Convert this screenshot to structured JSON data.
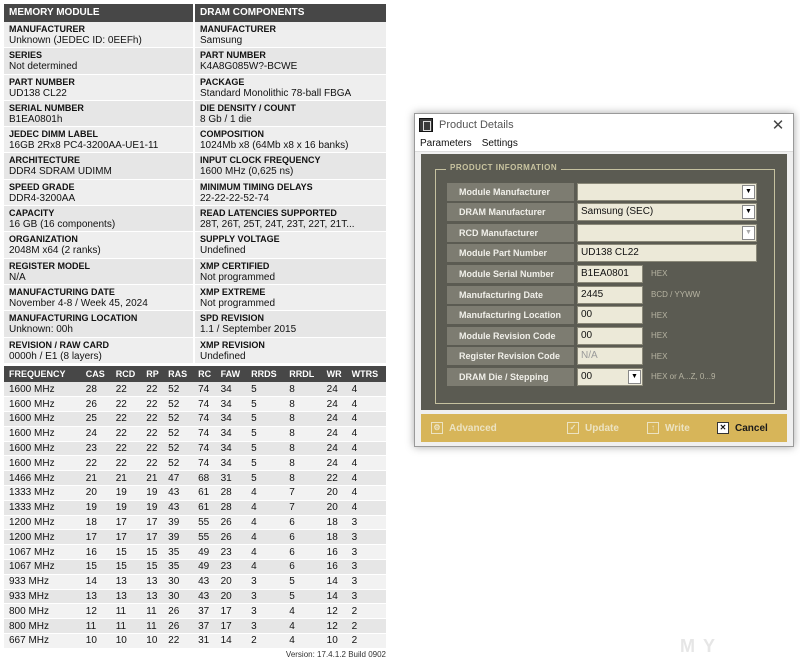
{
  "left_panel": {
    "headers": {
      "module": "MEMORY MODULE",
      "dram": "DRAM COMPONENTS"
    },
    "rows": [
      {
        "l_label": "MANUFACTURER",
        "l_value": "Unknown (JEDEC ID: 0EEFh)",
        "r_label": "MANUFACTURER",
        "r_value": "Samsung"
      },
      {
        "l_label": "SERIES",
        "l_value": "Not determined",
        "r_label": "PART NUMBER",
        "r_value": "K4A8G085W?-BCWE"
      },
      {
        "l_label": "PART NUMBER",
        "l_value": "UD138 CL22",
        "r_label": "PACKAGE",
        "r_value": "Standard Monolithic 78-ball FBGA"
      },
      {
        "l_label": "SERIAL NUMBER",
        "l_value": "B1EA0801h",
        "r_label": "DIE DENSITY / COUNT",
        "r_value": "8 Gb / 1 die"
      },
      {
        "l_label": "JEDEC DIMM LABEL",
        "l_value": "16GB 2Rx8 PC4-3200AA-UE1-11",
        "r_label": "COMPOSITION",
        "r_value": "1024Mb x8 (64Mb x8 x 16 banks)"
      },
      {
        "l_label": "ARCHITECTURE",
        "l_value": "DDR4 SDRAM UDIMM",
        "r_label": "INPUT CLOCK FREQUENCY",
        "r_value": "1600 MHz (0,625 ns)"
      },
      {
        "l_label": "SPEED GRADE",
        "l_value": "DDR4-3200AA",
        "r_label": "MINIMUM TIMING DELAYS",
        "r_value": "22-22-22-52-74"
      },
      {
        "l_label": "CAPACITY",
        "l_value": "16 GB (16 components)",
        "r_label": "READ LATENCIES SUPPORTED",
        "r_value": "28T, 26T, 25T, 24T, 23T, 22T, 21T..."
      },
      {
        "l_label": "ORGANIZATION",
        "l_value": "2048M x64 (2 ranks)",
        "r_label": "SUPPLY VOLTAGE",
        "r_value": "Undefined"
      },
      {
        "l_label": "REGISTER MODEL",
        "l_value": "N/A",
        "r_label": "XMP CERTIFIED",
        "r_value": "Not programmed"
      },
      {
        "l_label": "MANUFACTURING DATE",
        "l_value": "November 4-8 / Week 45, 2024",
        "r_label": "XMP EXTREME",
        "r_value": "Not programmed"
      },
      {
        "l_label": "MANUFACTURING LOCATION",
        "l_value": "Unknown: 00h",
        "r_label": "SPD REVISION",
        "r_value": "1.1 / September 2015"
      },
      {
        "l_label": "REVISION / RAW CARD",
        "l_value": "0000h / E1 (8 layers)",
        "r_label": "XMP REVISION",
        "r_value": "Undefined"
      }
    ],
    "timings": {
      "columns": [
        "FREQUENCY",
        "CAS",
        "RCD",
        "RP",
        "RAS",
        "RC",
        "FAW",
        "RRDS",
        "RRDL",
        "WR",
        "WTRS"
      ],
      "rows": [
        [
          "1600 MHz",
          "28",
          "22",
          "22",
          "52",
          "74",
          "34",
          "5",
          "8",
          "24",
          "4"
        ],
        [
          "1600 MHz",
          "26",
          "22",
          "22",
          "52",
          "74",
          "34",
          "5",
          "8",
          "24",
          "4"
        ],
        [
          "1600 MHz",
          "25",
          "22",
          "22",
          "52",
          "74",
          "34",
          "5",
          "8",
          "24",
          "4"
        ],
        [
          "1600 MHz",
          "24",
          "22",
          "22",
          "52",
          "74",
          "34",
          "5",
          "8",
          "24",
          "4"
        ],
        [
          "1600 MHz",
          "23",
          "22",
          "22",
          "52",
          "74",
          "34",
          "5",
          "8",
          "24",
          "4"
        ],
        [
          "1600 MHz",
          "22",
          "22",
          "22",
          "52",
          "74",
          "34",
          "5",
          "8",
          "24",
          "4"
        ],
        [
          "1466 MHz",
          "21",
          "21",
          "21",
          "47",
          "68",
          "31",
          "5",
          "8",
          "22",
          "4"
        ],
        [
          "1333 MHz",
          "20",
          "19",
          "19",
          "43",
          "61",
          "28",
          "4",
          "7",
          "20",
          "4"
        ],
        [
          "1333 MHz",
          "19",
          "19",
          "19",
          "43",
          "61",
          "28",
          "4",
          "7",
          "20",
          "4"
        ],
        [
          "1200 MHz",
          "18",
          "17",
          "17",
          "39",
          "55",
          "26",
          "4",
          "6",
          "18",
          "3"
        ],
        [
          "1200 MHz",
          "17",
          "17",
          "17",
          "39",
          "55",
          "26",
          "4",
          "6",
          "18",
          "3"
        ],
        [
          "1067 MHz",
          "16",
          "15",
          "15",
          "35",
          "49",
          "23",
          "4",
          "6",
          "16",
          "3"
        ],
        [
          "1067 MHz",
          "15",
          "15",
          "15",
          "35",
          "49",
          "23",
          "4",
          "6",
          "16",
          "3"
        ],
        [
          "933 MHz",
          "14",
          "13",
          "13",
          "30",
          "43",
          "20",
          "3",
          "5",
          "14",
          "3"
        ],
        [
          "933 MHz",
          "13",
          "13",
          "13",
          "30",
          "43",
          "20",
          "3",
          "5",
          "14",
          "3"
        ],
        [
          "800 MHz",
          "12",
          "11",
          "11",
          "26",
          "37",
          "17",
          "3",
          "4",
          "12",
          "2"
        ],
        [
          "800 MHz",
          "11",
          "11",
          "11",
          "26",
          "37",
          "17",
          "3",
          "4",
          "12",
          "2"
        ],
        [
          "667 MHz",
          "10",
          "10",
          "10",
          "22",
          "31",
          "14",
          "2",
          "4",
          "10",
          "2"
        ]
      ]
    },
    "version": "Version: 17.4.1.2 Build 0902"
  },
  "dialog": {
    "title": "Product Details",
    "close_glyph": "✕",
    "menu": [
      "Parameters",
      "Settings"
    ],
    "group_title": "PRODUCT INFORMATION",
    "fields": [
      {
        "label": "Module Manufacturer",
        "value": "",
        "hint": ""
      },
      {
        "label": "DRAM Manufacturer",
        "value": "Samsung (SEC)",
        "hint": ""
      },
      {
        "label": "RCD Manufacturer",
        "value": "",
        "hint": ""
      },
      {
        "label": "Module Part Number",
        "value": "UD138 CL22",
        "hint": ""
      },
      {
        "label": "Module Serial Number",
        "value": "B1EA0801",
        "hint": "HEX"
      },
      {
        "label": "Manufacturing Date",
        "value": "2445",
        "hint": "BCD / YYWW"
      },
      {
        "label": "Manufacturing Location",
        "value": "00",
        "hint": "HEX"
      },
      {
        "label": "Module Revision Code",
        "value": "00",
        "hint": "HEX"
      },
      {
        "label": "Register Revision Code",
        "value": "N/A",
        "hint": "HEX"
      },
      {
        "label": "DRAM Die / Stepping",
        "value": "00",
        "hint": "HEX or A...Z, 0...9"
      }
    ],
    "buttons": {
      "advanced": "Advanced",
      "update": "Update",
      "write": "Write",
      "cancel": "Cancel"
    }
  },
  "watermark": "MY",
  "colors": {
    "header_bg": "#474747",
    "dialog_content_bg": "#5b5b52",
    "button_bar_bg": "#d7b559"
  }
}
